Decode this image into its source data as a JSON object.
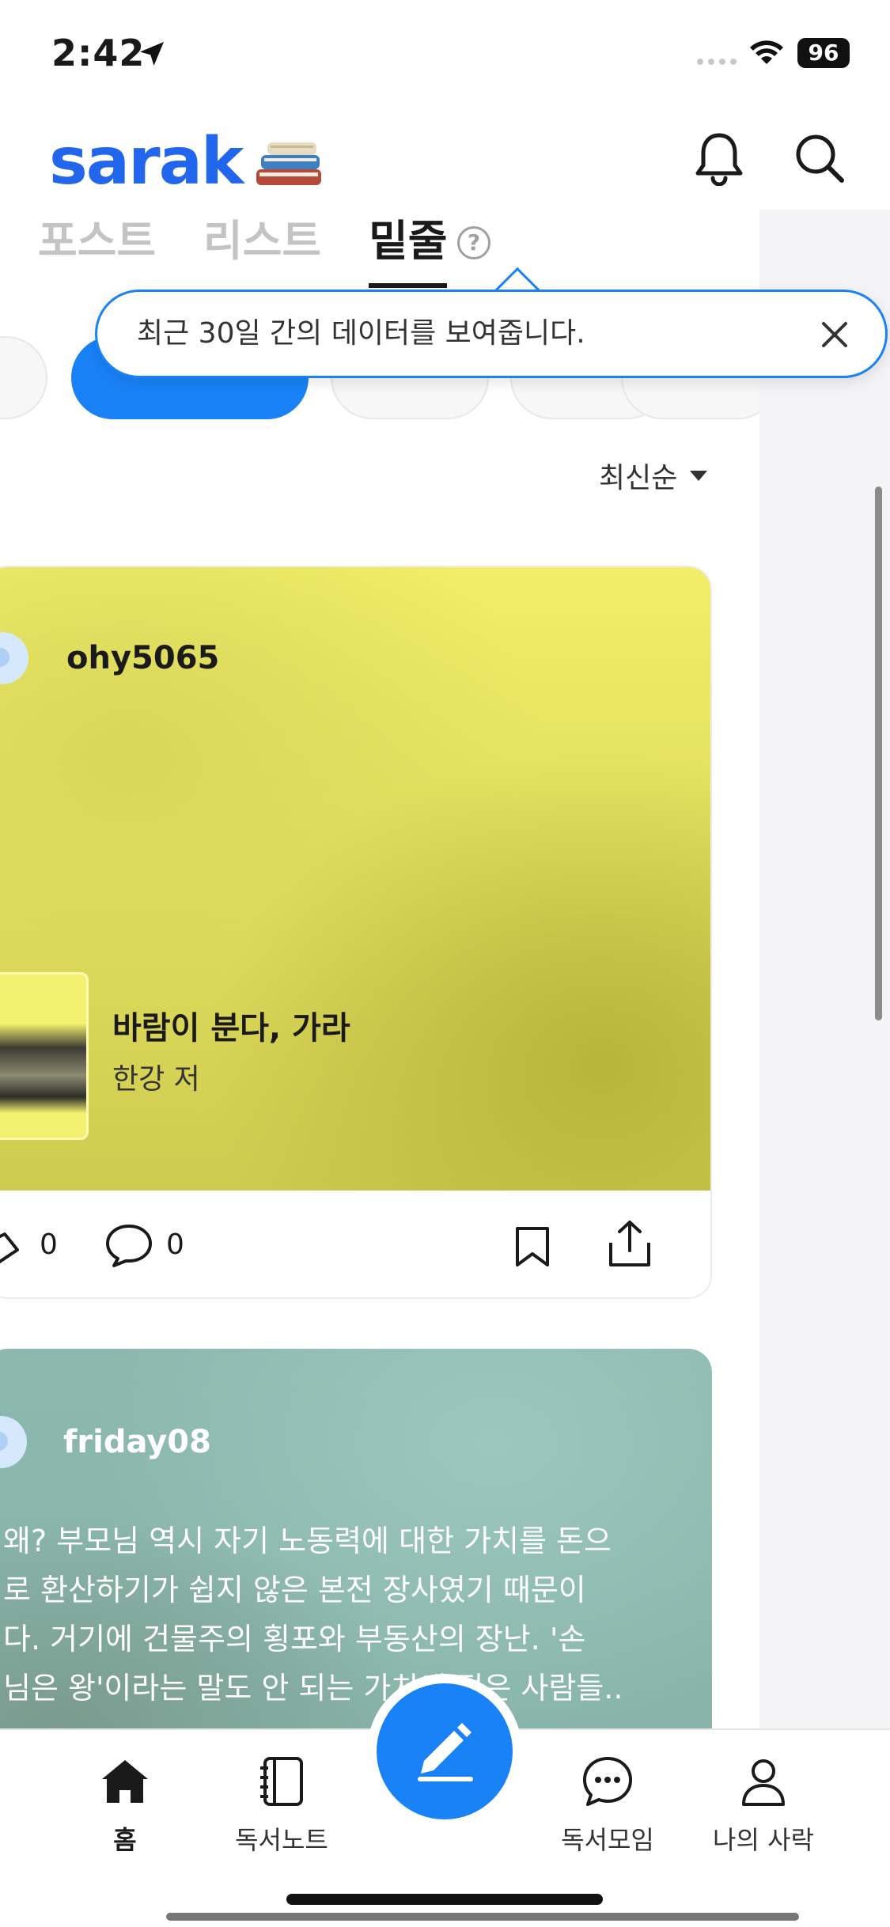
{
  "status_bar": {
    "time": "2:42",
    "battery": "96"
  },
  "header": {
    "logo": "sarak"
  },
  "tabs": [
    {
      "label": "포스트"
    },
    {
      "label": "리스트"
    },
    {
      "label": "밑줄"
    }
  ],
  "help": {
    "symbol": "?"
  },
  "tooltip": {
    "text": "최근 30일 간의 데이터를 보여줍니다."
  },
  "sort": {
    "label": "최신순"
  },
  "posts": [
    {
      "username": "ohy5065",
      "book_title": "바람이 분다, 가라",
      "book_author": "한강 저",
      "likes": "0",
      "comments": "0"
    },
    {
      "username": "friday08",
      "quote_lines": [
        "왜? 부모님 역시 자기 노동력에 대한 가치를 돈으",
        "로 환산하기가 쉽지 않은 본전 장사였기 때문이",
        "다. 거기에 건물주의 횡포와  부동산의 장난.  '손",
        "님은 왕'이라는 말도 안 되는 가치에 젖은 사람들.."
      ]
    }
  ],
  "bottom_nav": [
    {
      "label": "홈",
      "icon": "home-icon"
    },
    {
      "label": "독서노트",
      "icon": "notebook-icon"
    },
    {
      "label": "",
      "icon": "pencil-icon"
    },
    {
      "label": "독서모임",
      "icon": "chat-icon"
    },
    {
      "label": "나의 사락",
      "icon": "person-icon"
    }
  ],
  "colors": {
    "accent": "#1a82f7",
    "logo": "#2266ee"
  }
}
